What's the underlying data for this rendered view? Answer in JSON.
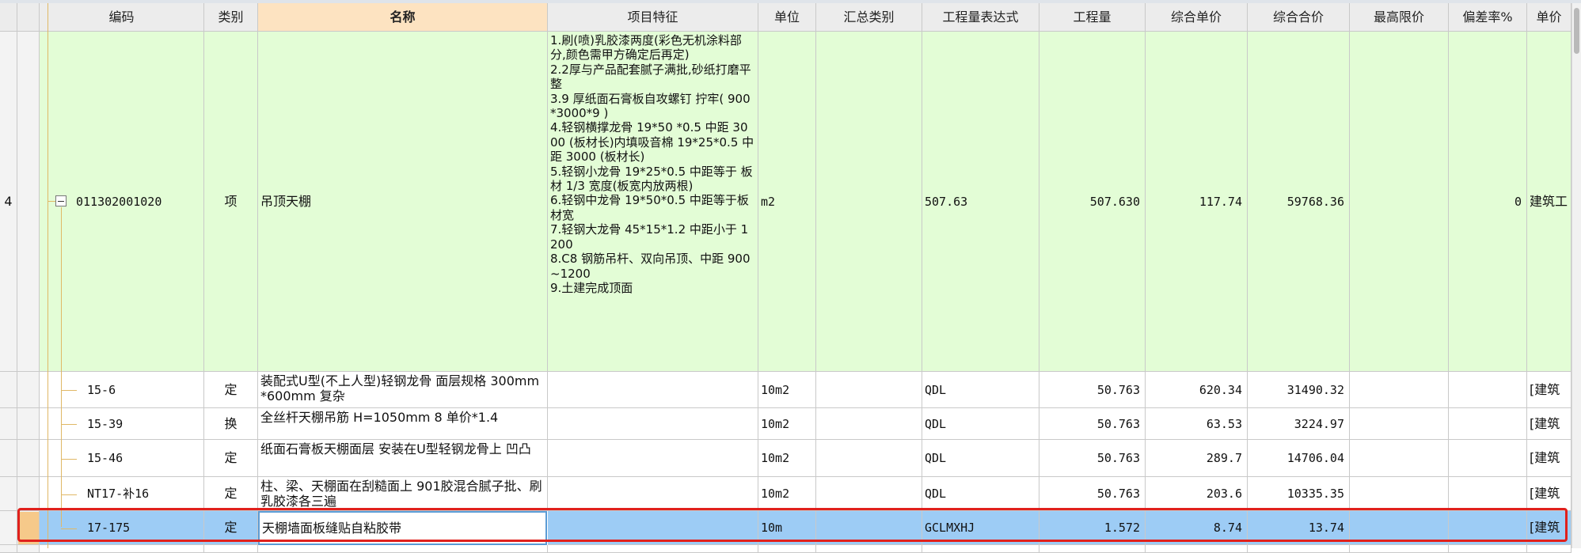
{
  "columns": [
    "",
    "",
    "编码",
    "类别",
    "名称",
    "项目特征",
    "单位",
    "汇总类别",
    "工程量表达式",
    "工程量",
    "综合单价",
    "综合合价",
    "最高限价",
    "偏差率%",
    "单价"
  ],
  "parent_row": {
    "index": "4",
    "code": "011302001020",
    "category": "项",
    "name": "吊顶天棚",
    "features": "1.刷(喷)乳胶漆两度(彩色无机涂料部分,颜色需甲方确定后再定)\n2.2厚与产品配套腻子满批,砂纸打磨平整\n3.9 厚纸面石膏板自攻螺钉 拧牢( 900*3000*9 )\n4.轻钢横撑龙骨 19*50 *0.5 中距 3000 (板材长)内填吸音棉 19*25*0.5 中距 3000 (板材长)\n5.轻钢小龙骨 19*25*0.5 中距等于 板材 1/3 宽度(板宽内放两根)\n6.轻钢中龙骨 19*50*0.5 中距等于板材宽\n7.轻钢大龙骨 45*15*1.2 中距小于 1200\n8.C8 钢筋吊杆、双向吊顶、中距 900~1200\n9.土建完成顶面",
    "unit": "m2",
    "expr": "507.63",
    "qty": "507.630",
    "unit_price": "117.74",
    "total": "59768.36",
    "max_price": "",
    "dev": "0",
    "price_spec": "建筑工"
  },
  "rows": [
    {
      "code": "15-6",
      "category": "定",
      "name": "装配式U型(不上人型)轻钢龙骨 面层规格 300mm*600mm 复杂",
      "unit": "10m2",
      "expr": "QDL",
      "qty": "50.763",
      "unit_price": "620.34",
      "total": "31490.32",
      "price_spec": "[建筑"
    },
    {
      "code": "15-39",
      "category": "换",
      "name": "全丝杆天棚吊筋 H=1050mm 8 单价*1.4",
      "unit": "10m2",
      "expr": "QDL",
      "qty": "50.763",
      "unit_price": "63.53",
      "total": "3224.97",
      "price_spec": "[建筑"
    },
    {
      "code": "15-46",
      "category": "定",
      "name": "纸面石膏板天棚面层 安装在U型轻钢龙骨上 凹凸",
      "unit": "10m2",
      "expr": "QDL",
      "qty": "50.763",
      "unit_price": "289.7",
      "total": "14706.04",
      "price_spec": "[建筑"
    },
    {
      "code": "NT17-补16",
      "category": "定",
      "name": "柱、梁、天棚面在刮糙面上 901胶混合腻子批、刷乳胶漆各三遍",
      "unit": "10m2",
      "expr": "QDL",
      "qty": "50.763",
      "unit_price": "203.6",
      "total": "10335.35",
      "price_spec": "[建筑"
    },
    {
      "code": "17-175",
      "category": "定",
      "name": "天棚墙面板缝贴自粘胶带",
      "unit": "10m",
      "expr": "GCLMXHJ",
      "qty": "1.572",
      "unit_price": "8.74",
      "total": "13.74",
      "price_spec": "[建筑"
    }
  ],
  "colors": {
    "parent_row_bg": "#e3fdd6",
    "selected_row_bg": "#9dccf5",
    "highlight_box": "#e0201c",
    "active_header_bg": "#fde3c1"
  }
}
